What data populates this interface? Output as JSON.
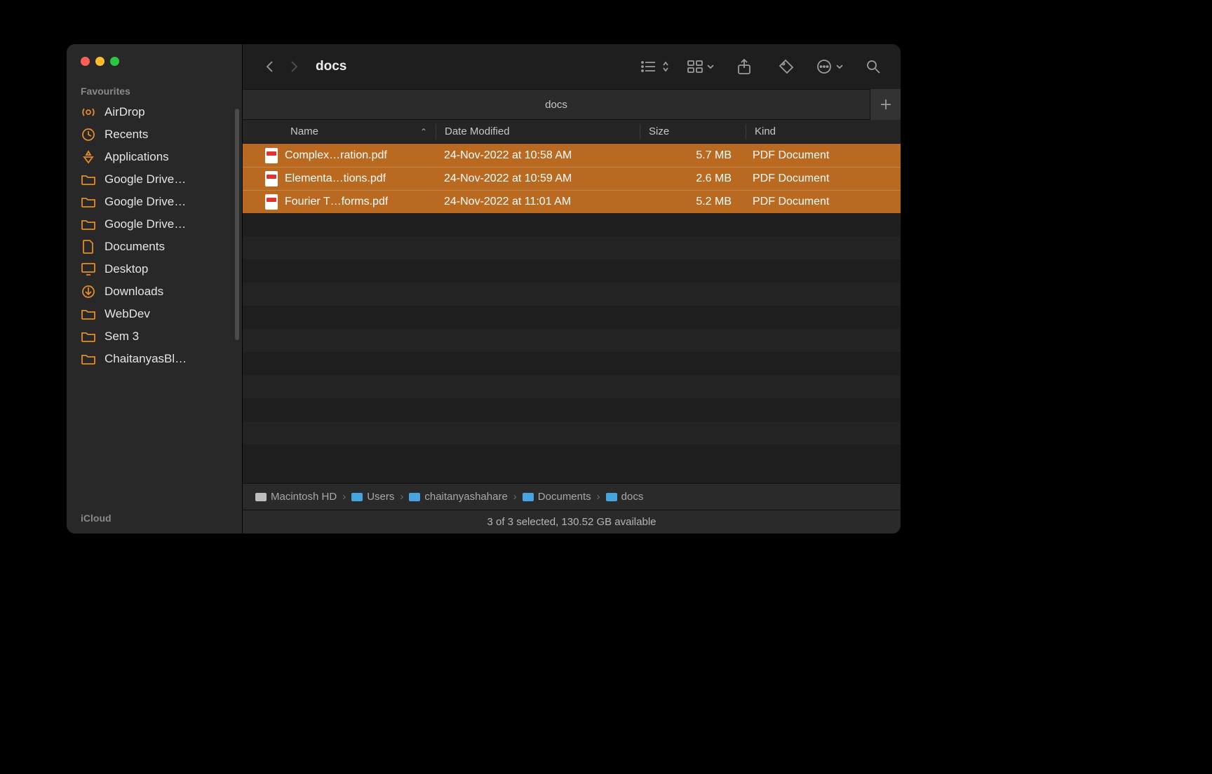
{
  "window_title": "docs",
  "sidebar": {
    "section_favourites": "Favourites",
    "section_icloud": "iCloud",
    "items": [
      {
        "label": "AirDrop",
        "icon": "airdrop"
      },
      {
        "label": "Recents",
        "icon": "clock"
      },
      {
        "label": "Applications",
        "icon": "apps"
      },
      {
        "label": "Google Drive…",
        "icon": "folder"
      },
      {
        "label": "Google Drive…",
        "icon": "folder"
      },
      {
        "label": "Google Drive…",
        "icon": "folder"
      },
      {
        "label": "Documents",
        "icon": "doc"
      },
      {
        "label": "Desktop",
        "icon": "desktop"
      },
      {
        "label": "Downloads",
        "icon": "download"
      },
      {
        "label": "WebDev",
        "icon": "folder"
      },
      {
        "label": "Sem 3",
        "icon": "folder"
      },
      {
        "label": "ChaitanyasBl…",
        "icon": "folder"
      }
    ]
  },
  "tabs": {
    "active": "docs"
  },
  "columns": {
    "name": "Name",
    "date": "Date Modified",
    "size": "Size",
    "kind": "Kind"
  },
  "files": [
    {
      "name": "Complex…ration.pdf",
      "date": "24-Nov-2022 at 10:58 AM",
      "size": "5.7 MB",
      "kind": "PDF Document",
      "selected": true
    },
    {
      "name": "Elementa…tions.pdf",
      "date": "24-Nov-2022 at 10:59 AM",
      "size": "2.6 MB",
      "kind": "PDF Document",
      "selected": true
    },
    {
      "name": "Fourier T…forms.pdf",
      "date": "24-Nov-2022 at 11:01 AM",
      "size": "5.2 MB",
      "kind": "PDF Document",
      "selected": true
    }
  ],
  "path": [
    "Macintosh HD",
    "Users",
    "chaitanyashahare",
    "Documents",
    "docs"
  ],
  "status": "3 of 3 selected, 130.52 GB available"
}
